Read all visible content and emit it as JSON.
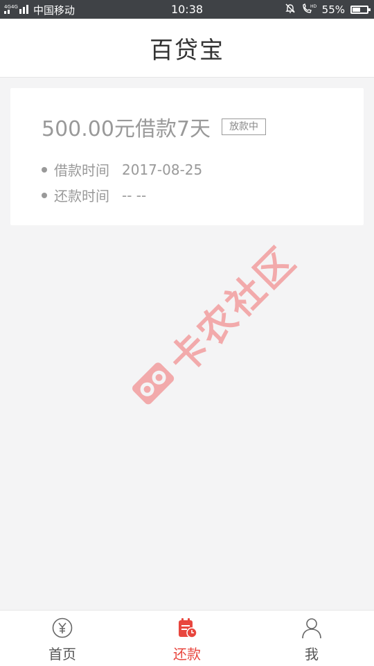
{
  "status_bar": {
    "network": "4G 4G",
    "carrier": "中国移动",
    "time": "10:38",
    "battery": "55%",
    "battery_level": 0.55
  },
  "header": {
    "title": "百贷宝"
  },
  "loan": {
    "title": "500.00元借款7天",
    "status": "放款中",
    "rows": [
      {
        "label": "借款时间",
        "value": "2017-08-25"
      },
      {
        "label": "还款时间",
        "value": "-- --"
      }
    ]
  },
  "watermark": {
    "text": "卡农社区"
  },
  "tabs": [
    {
      "label": "首页",
      "icon": "yen-circle-icon"
    },
    {
      "label": "还款",
      "icon": "repay-calendar-icon",
      "active": true
    },
    {
      "label": "我",
      "icon": "user-icon"
    }
  ],
  "colors": {
    "accent": "#e8463e",
    "status_bar": "#3f4246",
    "background": "#f4f4f5"
  }
}
